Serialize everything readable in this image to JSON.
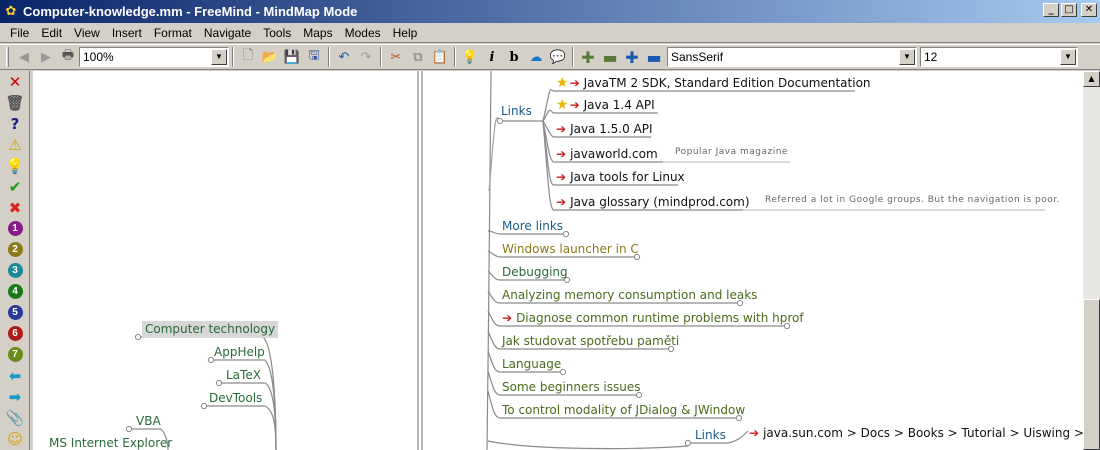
{
  "window": {
    "title": "Computer-knowledge.mm - FreeMind - MindMap Mode",
    "buttons": {
      "minimize": "_",
      "maximize": "□",
      "close": "✕"
    }
  },
  "menu": [
    "File",
    "Edit",
    "View",
    "Insert",
    "Format",
    "Navigate",
    "Tools",
    "Maps",
    "Modes",
    "Help"
  ],
  "toolbar": {
    "zoom": "100%",
    "font": "SansSerif",
    "font_size": "12"
  },
  "left_icons": [
    {
      "name": "cross-icon",
      "glyph": "✕",
      "color": "#cc0000"
    },
    {
      "name": "trash-icon",
      "glyph": "🗑",
      "color": "#555555"
    },
    {
      "name": "question-icon",
      "glyph": "?",
      "color": "#1a1a8a"
    },
    {
      "name": "warning-icon",
      "glyph": "⚠",
      "color": "#d4a000"
    },
    {
      "name": "idea-icon",
      "glyph": "💡",
      "color": "#e8b800"
    },
    {
      "name": "check-icon",
      "glyph": "✔",
      "color": "#1a9a1a"
    },
    {
      "name": "no-icon",
      "glyph": "✖",
      "color": "#dd2222"
    },
    {
      "name": "priority-1-icon",
      "num": "1",
      "color": "#8a1a8a"
    },
    {
      "name": "priority-2-icon",
      "num": "2",
      "color": "#8a7a1a"
    },
    {
      "name": "priority-3-icon",
      "num": "3",
      "color": "#1a8a9a"
    },
    {
      "name": "priority-4-icon",
      "num": "4",
      "color": "#1a7a1a"
    },
    {
      "name": "priority-5-icon",
      "num": "5",
      "color": "#2a3a9a"
    },
    {
      "name": "priority-6-icon",
      "num": "6",
      "color": "#b01a1a"
    },
    {
      "name": "priority-7-icon",
      "num": "7",
      "color": "#6a8a1a"
    },
    {
      "name": "back-arrow-icon",
      "glyph": "⬅",
      "color": "#1a9ac8"
    },
    {
      "name": "forward-arrow-icon",
      "glyph": "➡",
      "color": "#1a9ac8"
    },
    {
      "name": "attach-icon",
      "glyph": "📎",
      "color": "#555555"
    },
    {
      "name": "smiley-icon",
      "glyph": "☺",
      "color": "#d4a000"
    }
  ],
  "nodes": {
    "computer_technology": "Computer technology",
    "apphelp": "AppHelp",
    "latex": "LaTeX",
    "devtools": "DevTools",
    "vba": "VBA",
    "ms_ie": "MS Internet Explorer",
    "links": "Links",
    "java2_sdk": "JavaTM 2 SDK, Standard Edition  Documentation",
    "java14": "Java 1.4 API",
    "java15": "Java 1.5.0 API",
    "javaworld": "javaworld.com",
    "javaworld_note": "Popular Java magazine",
    "java_tools": "Java tools for Linux",
    "java_glossary": "Java glossary  (mindprod.com)",
    "glossary_note": "Referred a lot in Google groups. But the navigation is poor.",
    "more_links": "More links",
    "windows_launcher": "Windows launcher in C",
    "debugging": "Debugging",
    "analyzing_memory": "Analyzing memory consumption and leaks",
    "diagnose": "Diagnose common runtime problems with hprof",
    "jak_studovat": "Jak studovat spotřebu paměti",
    "language": "Language",
    "beginners": "Some beginners issues",
    "modality": "To control modality of JDialog & JWindow",
    "links2": "Links",
    "sun_tutorial": "java.sun.com > Docs > Books > Tutorial > Uiswing > Comp"
  }
}
